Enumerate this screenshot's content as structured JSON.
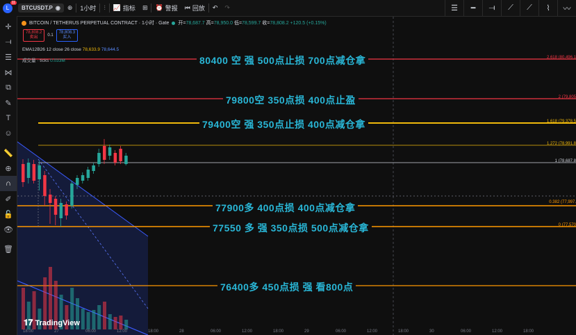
{
  "toolbar": {
    "avatar_letter": "L",
    "notifications": "11",
    "symbol": "BTCUSDT.P",
    "add_icon": "plus-icon",
    "timeframe": "1小时",
    "indicators_label": "指标",
    "alert_label": "警报",
    "replay_label": "回放"
  },
  "legend": {
    "title": "BITCOIN / TETHERUS PERPETUAL CONTRACT · 1小时 · Gate",
    "open_k": "开=",
    "open_v": "78,687.7",
    "high_k": "高=",
    "high_v": "78,950.0",
    "low_k": "低=",
    "low_v": "78,599.7",
    "close_k": "收=",
    "close_v": "78,808.2",
    "change": "+120.5 (+0.15%)",
    "sell_price": "78,808.2",
    "sell_label": "卖出",
    "spread": "0.1",
    "buy_price": "78,808.3",
    "buy_label": "买入",
    "ema_label": "EMA12B26 12 close 26 close",
    "ema_v1": "78,633.9",
    "ema_v2": "78,644.5",
    "volume_label": "成交量 · ticks",
    "volume_value": "0.033M"
  },
  "annotations": [
    {
      "text": "80400 空 强    500点止损    700点减仓拿",
      "color": "#f23645"
    },
    {
      "text": "79800空    350点损 400点止盈",
      "color": "#f23645"
    },
    {
      "text": "79400空 强    350点止损    400点减仓拿",
      "color": "#f0b90b"
    },
    {
      "text": "77900多      400点损     400点减仓拿",
      "color": "#ff9800"
    },
    {
      "text": "77550 多 强  350点损  500点减仓拿",
      "color": "#ff9800"
    },
    {
      "text": "76400多      450点损 强      看800点",
      "color": "#ff9800"
    }
  ],
  "fib_labels": [
    {
      "text": "2.618 (80,496.1",
      "color": "#f23645"
    },
    {
      "text": "2 (79,805",
      "color": "#f23645"
    },
    {
      "text": "1.618 (79,378.5",
      "color": "#f0b90b"
    },
    {
      "text": "1.272 (78,991.8",
      "color": "#f0b90b"
    },
    {
      "text": "1 (78,687.8",
      "color": "#d1d4dc"
    },
    {
      "text": "0.382 (77,997.",
      "color": "#ff9800"
    },
    {
      "text": "0 (77,570",
      "color": "#ff9800"
    }
  ],
  "xaxis": [
    "18:00",
    "27",
    "06:00",
    "12:00",
    "18:00",
    "28",
    "06:00",
    "12:00",
    "18:00",
    "29",
    "06:00",
    "12:00",
    "18:00",
    "30",
    "06:00",
    "12:00",
    "18:00"
  ],
  "brand": "TradingView",
  "colors": {
    "up": "#26a69a",
    "down": "#f23645",
    "accent": "#29b6d6"
  }
}
